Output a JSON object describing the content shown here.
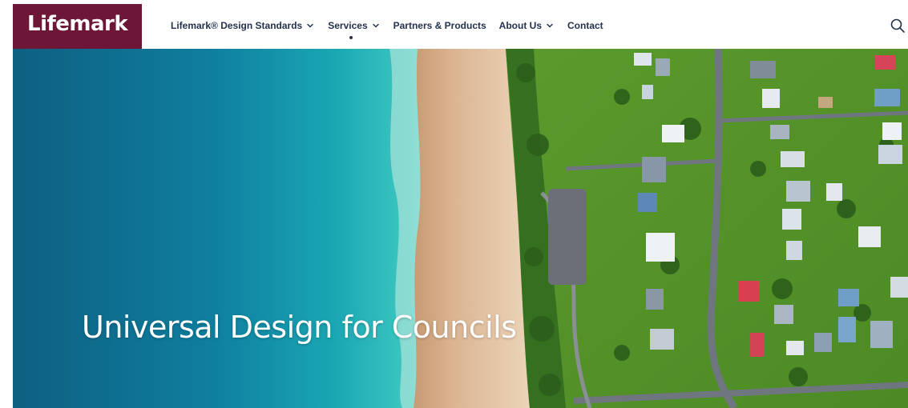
{
  "brand": {
    "name": "Lifemark",
    "color": "#6d1638"
  },
  "nav": {
    "items": [
      {
        "label": "Lifemark® Design Standards",
        "has_dropdown": true
      },
      {
        "label": "Services",
        "has_dropdown": true,
        "active": true
      },
      {
        "label": "Partners & Products",
        "has_dropdown": false
      },
      {
        "label": "About Us",
        "has_dropdown": true
      },
      {
        "label": "Contact",
        "has_dropdown": false
      }
    ],
    "text_color": "#24324d"
  },
  "search": {
    "icon": "search-icon"
  },
  "hero": {
    "title": "Universal Design for Councils",
    "image": "aerial-coastline-photo"
  }
}
